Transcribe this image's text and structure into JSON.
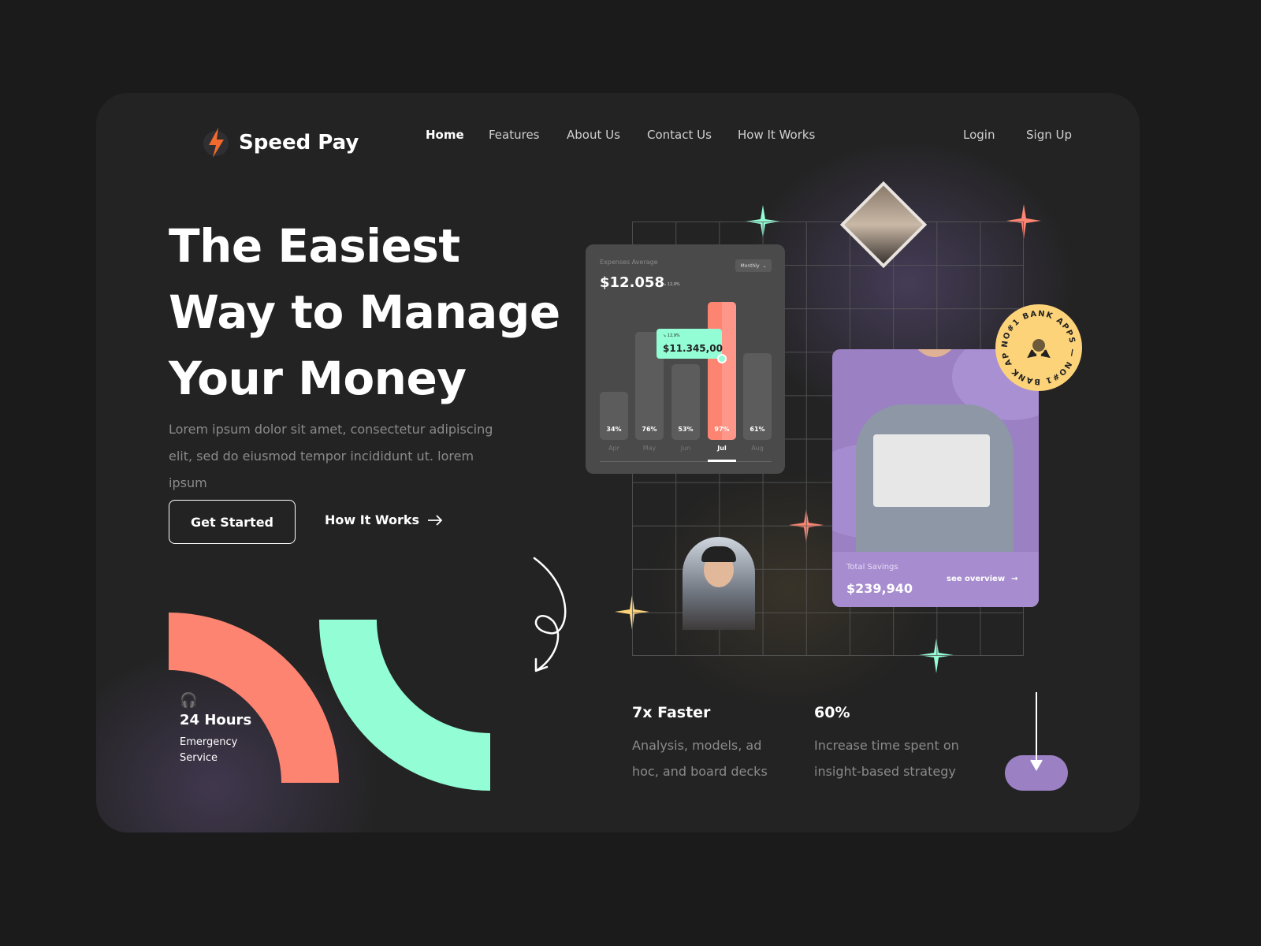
{
  "brand": {
    "name": "Speed Pay",
    "accent": "#f26a2e"
  },
  "nav": {
    "items": [
      "Home",
      "Features",
      "About Us",
      "Contact Us",
      "How It Works"
    ],
    "active": "Home",
    "login": "Login",
    "signup": "Sign Up"
  },
  "hero": {
    "line1": "The Easiest",
    "line2": "Way to Manage",
    "line3": "Your Money",
    "lead": "Lorem ipsum dolor sit amet, consectetur adipiscing elit, sed do eiusmod tempor incididunt ut. lorem ipsum",
    "cta": "Get Started",
    "secondary": "How It Works"
  },
  "expenses": {
    "label": "Expenses Average",
    "amount": "$12.058",
    "change": "12,9%",
    "period": "Monthly",
    "tooltip_change": "12,9%",
    "tooltip_amount": "$11.345,00",
    "bars": [
      {
        "month": "Apr",
        "pct": 34
      },
      {
        "month": "May",
        "pct": 76
      },
      {
        "month": "Jun",
        "pct": 53
      },
      {
        "month": "Jul",
        "pct": 97,
        "active": true
      },
      {
        "month": "Aug",
        "pct": 61
      }
    ]
  },
  "savings": {
    "label": "Total Savings",
    "amount": "$239,940",
    "link": "see overview"
  },
  "badge": {
    "text": "NO#1 BANK APPS — NO#1 BANK APPS —"
  },
  "service": {
    "title": "24 Hours",
    "subtitle1": "Emergency",
    "subtitle2": "Service"
  },
  "stats": [
    {
      "title": "7x Faster",
      "desc": "Analysis, models, ad hoc, and board decks"
    },
    {
      "title": "60%",
      "desc": "Increase time spent on insight-based strategy"
    }
  ],
  "colors": {
    "coral": "#fe8472",
    "mint": "#93fdd5",
    "purple": "#9b80c4",
    "yellow": "#fdd37a"
  }
}
